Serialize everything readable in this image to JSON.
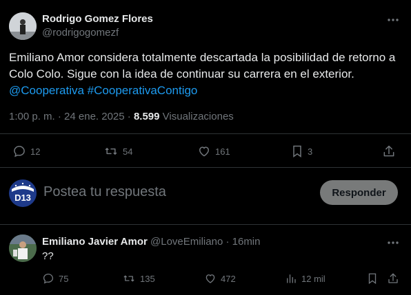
{
  "post": {
    "author_name": "Rodrigo Gomez Flores",
    "author_handle": "@rodrigogomezf",
    "text_plain": "Emiliano Amor considera totalmente descartada la posibilidad de retorno a Colo Colo. Sigue con la idea de continuar su carrera en el exterior.",
    "hashtag_1": "@Cooperativa",
    "hashtag_2": "#CooperativaContigo",
    "timestamp": "1:00 p. m. · 24 ene. 2025 · ",
    "views_count": "8.599",
    "views_label": " Visualizaciones",
    "replies": "12",
    "reposts": "54",
    "likes": "161",
    "bookmarks": "3"
  },
  "composer": {
    "avatar_text": "D13",
    "placeholder": "Postea tu respuesta",
    "reply_label": "Responder"
  },
  "reply": {
    "author_name": "Emiliano Javier Amor",
    "author_handle": "@LoveEmiliano",
    "time": "· 16min",
    "text": "??",
    "replies": "75",
    "reposts": "135",
    "likes": "472",
    "views": "12 mil"
  },
  "colors": {
    "background": "#000000",
    "text": "#e7e9ea",
    "muted": "#71767b",
    "link": "#1d9bf0",
    "divider": "#2f3336"
  }
}
